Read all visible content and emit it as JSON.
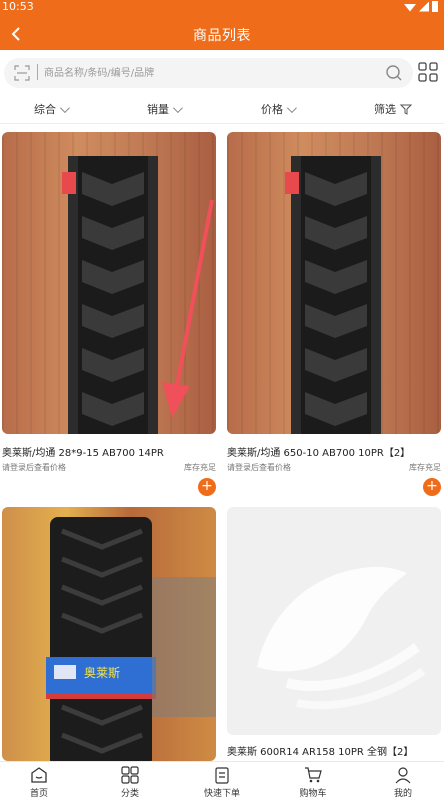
{
  "status": {
    "time": "10:53"
  },
  "header": {
    "title": "商品列表"
  },
  "search": {
    "placeholder": "商品名称/条码/编号/品牌"
  },
  "filters": [
    {
      "label": "综合"
    },
    {
      "label": "销量"
    },
    {
      "label": "价格"
    },
    {
      "label": "筛选"
    }
  ],
  "products": [
    {
      "name": "奥莱斯/均通 28*9-15 AB700 14PR",
      "login_hint": "请登录后查看价格",
      "stock": "库存充足",
      "add": "+"
    },
    {
      "name": "奥莱斯/均通 650-10 AB700 10PR【2】",
      "login_hint": "请登录后查看价格",
      "stock": "库存充足",
      "add": "+"
    },
    {
      "name": "",
      "login_hint": "",
      "stock": "",
      "label_on_tire": "奥莱斯"
    },
    {
      "name": "奥莱斯 600R14 AR158 10PR 全钢【2】",
      "login_hint": "",
      "stock": ""
    }
  ],
  "tabbar": [
    {
      "label": "首页",
      "icon": "home-icon"
    },
    {
      "label": "分类",
      "icon": "category-icon"
    },
    {
      "label": "快速下单",
      "icon": "quick-order-icon"
    },
    {
      "label": "购物车",
      "icon": "cart-icon"
    },
    {
      "label": "我的",
      "icon": "profile-icon"
    }
  ],
  "colors": {
    "accent": "#ef6c1a",
    "arrow": "#f0505a"
  }
}
